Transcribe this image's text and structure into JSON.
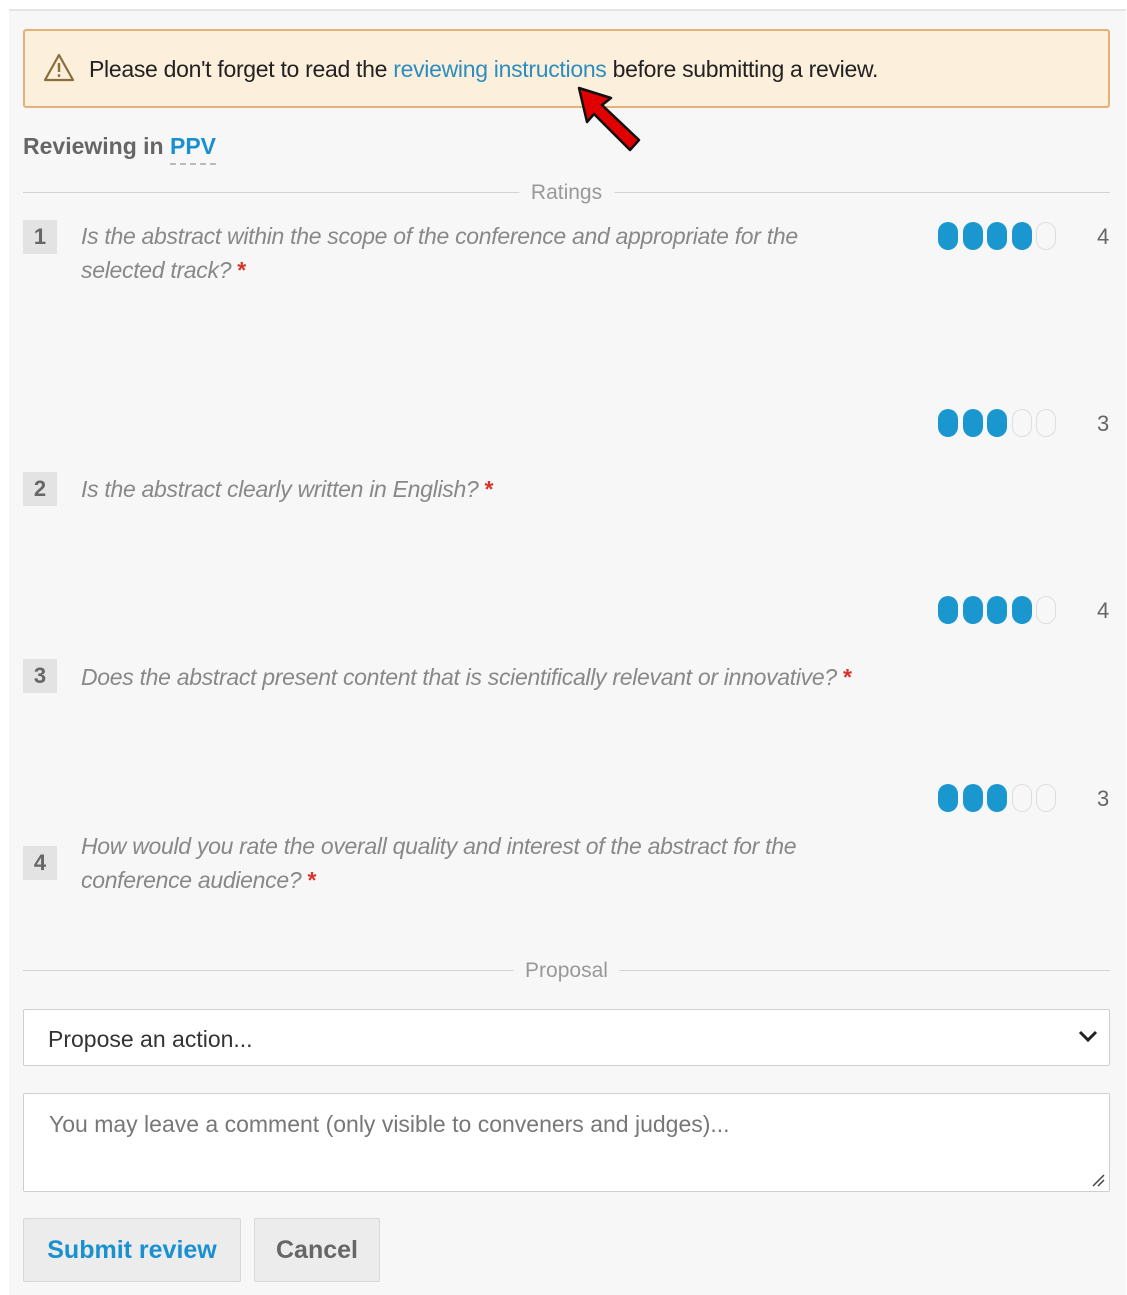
{
  "alert": {
    "before": "Please don't forget to read the ",
    "link": "reviewing instructions",
    "after": " before submitting a review."
  },
  "header": {
    "prefix": "Reviewing in ",
    "track": "PPV"
  },
  "sections": {
    "ratings": "Ratings",
    "proposal": "Proposal"
  },
  "questions": [
    {
      "num": "1",
      "text": "Is the abstract within the scope of the conference and appropriate for the selected track?",
      "required": "*",
      "rating": 4,
      "rating_label": "4"
    },
    {
      "num": "2",
      "text": "Is the abstract clearly written in English?",
      "required": "*",
      "rating": 3,
      "rating_label": "3"
    },
    {
      "num": "3",
      "text": "Does the abstract present content that is scientifically relevant or innovative?",
      "required": "*",
      "rating": 4,
      "rating_label": "4"
    },
    {
      "num": "4",
      "text": "How would you rate the overall quality and interest of the abstract for the conference audience?",
      "required": "*",
      "rating": 3,
      "rating_label": "3"
    }
  ],
  "rating_max": 5,
  "proposal": {
    "select_value": "Propose an action...",
    "comment_placeholder": "You may leave a comment (only visible to conveners and judges)..."
  },
  "buttons": {
    "submit": "Submit review",
    "cancel": "Cancel"
  },
  "colors": {
    "accent": "#1b97cf",
    "link": "#2c8dc1",
    "alert_bg": "#fcefdc",
    "alert_border": "#e4b178",
    "required": "#d9342b",
    "pointer_arrow": "#e00000"
  }
}
